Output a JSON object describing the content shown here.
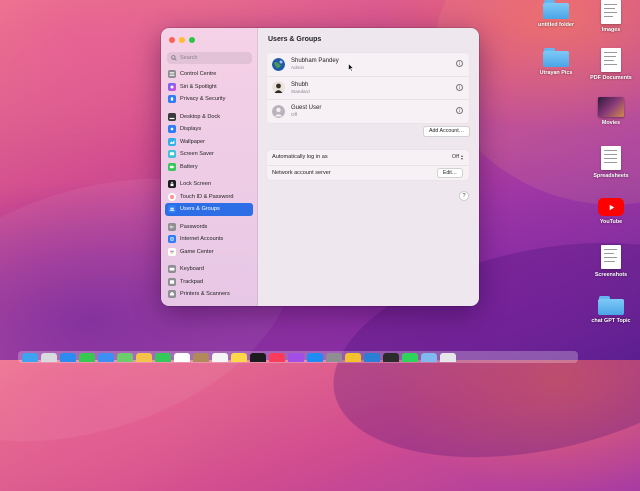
{
  "window": {
    "title": "Users & Groups",
    "search_placeholder": "Search",
    "sidebar": [
      {
        "label": "Control Centre",
        "icon": "control-centre-icon",
        "color": "#8e8e93"
      },
      {
        "label": "Siri & Spotlight",
        "icon": "siri-icon",
        "color": "#c24ad8"
      },
      {
        "label": "Privacy & Security",
        "icon": "hand-icon",
        "color": "#2f7cf6"
      },
      {
        "label": "Desktop & Dock",
        "icon": "desktop-dock-icon",
        "color": "#3a3a3c"
      },
      {
        "label": "Displays",
        "icon": "sun-icon",
        "color": "#2f7cf6"
      },
      {
        "label": "Wallpaper",
        "icon": "wallpaper-icon",
        "color": "#30b0e8"
      },
      {
        "label": "Screen Saver",
        "icon": "screen-saver-icon",
        "color": "#41c1d8"
      },
      {
        "label": "Battery",
        "icon": "battery-icon",
        "color": "#34c759"
      },
      {
        "label": "Lock Screen",
        "icon": "lock-icon",
        "color": "#1c1c1e"
      },
      {
        "label": "Touch ID & Password",
        "icon": "fingerprint-icon",
        "color": "#ff5a5f"
      },
      {
        "label": "Users & Groups",
        "icon": "users-icon",
        "color": "#2f7cf6",
        "active": true
      },
      {
        "label": "Passwords",
        "icon": "key-icon",
        "color": "#8e8e93"
      },
      {
        "label": "Internet Accounts",
        "icon": "at-icon",
        "color": "#2f7cf6"
      },
      {
        "label": "Game Center",
        "icon": "game-center-icon",
        "color": "#ffffff"
      },
      {
        "label": "Keyboard",
        "icon": "keyboard-icon",
        "color": "#8e8e93"
      },
      {
        "label": "Trackpad",
        "icon": "trackpad-icon",
        "color": "#8e8e93"
      },
      {
        "label": "Printers & Scanners",
        "icon": "printer-icon",
        "color": "#8e8e93"
      }
    ],
    "users": [
      {
        "name": "Shubham Pandey",
        "role": "Admin",
        "avatar": "earth-avatar"
      },
      {
        "name": "Shubh",
        "role": "Standard",
        "avatar": "portrait-avatar"
      },
      {
        "name": "Guest User",
        "role": "Off",
        "avatar": "generic-avatar"
      }
    ],
    "add_account_label": "Add Account…",
    "auto_login": {
      "label": "Automatically log in as",
      "value": "Off"
    },
    "network_server": {
      "label": "Network account server",
      "button": "Edit…"
    },
    "help_label": "?",
    "info_label": "i"
  },
  "desktop": [
    {
      "label": "untitled folder",
      "type": "folder"
    },
    {
      "label": "Images",
      "type": "doc"
    },
    {
      "label": "Utrayan Pics",
      "type": "folder"
    },
    {
      "label": "PDF Documents",
      "type": "doc"
    },
    {
      "label": "Movies",
      "type": "photo"
    },
    {
      "label": "Spreadsheets",
      "type": "doc"
    },
    {
      "label": "YouTube",
      "type": "youtube"
    },
    {
      "label": "Screenshots",
      "type": "doc"
    },
    {
      "label": "chat GPT Topic",
      "type": "folder"
    }
  ],
  "colors": {
    "accent": "#2d6ee6",
    "folder": "#5ab0ee"
  }
}
